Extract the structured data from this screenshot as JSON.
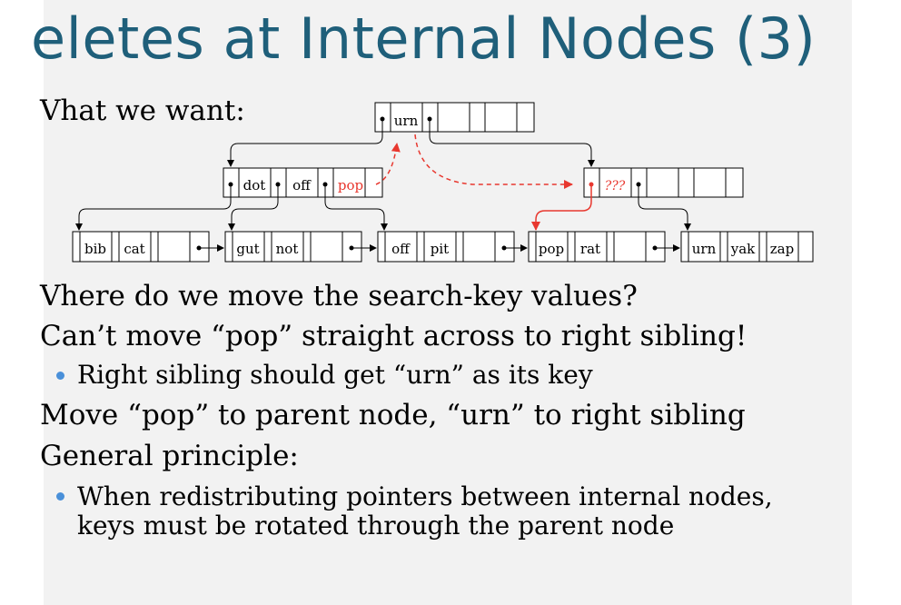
{
  "slide": {
    "title": "eletes at Internal Nodes (3)",
    "body": [
      {
        "level": 1,
        "text": "Vhat we want:"
      },
      {
        "level": 1,
        "text": "Vhere do we move the search-key values?"
      },
      {
        "level": 1,
        "text": "Can’t move “pop” straight across to right sibling!"
      },
      {
        "level": 2,
        "text": "Right sibling should get “urn” as its key"
      },
      {
        "level": 1,
        "text": "Move “pop” to parent node, “urn” to right sibling"
      },
      {
        "level": 1,
        "text": "General principle:"
      },
      {
        "level": 2,
        "text": "When redistributing pointers between internal nodes,"
      },
      {
        "level": 2,
        "text": "keys must be rotated through the parent node"
      }
    ]
  },
  "diagram": {
    "root": {
      "keys": [
        "urn"
      ]
    },
    "left_internal": {
      "keys": [
        "dot",
        "off",
        "pop"
      ]
    },
    "right_internal": {
      "keys": [
        "???"
      ]
    },
    "leaves": [
      {
        "keys": [
          "bib",
          "cat"
        ]
      },
      {
        "keys": [
          "gut",
          "not"
        ]
      },
      {
        "keys": [
          "off",
          "pit"
        ]
      },
      {
        "keys": [
          "pop",
          "rat"
        ]
      },
      {
        "keys": [
          "urn",
          "yak",
          "zap"
        ]
      }
    ],
    "colors": {
      "highlight": "#e8382f",
      "line": "#000000",
      "title": "#1f5f7a",
      "bullet": "#4a90d9"
    }
  }
}
